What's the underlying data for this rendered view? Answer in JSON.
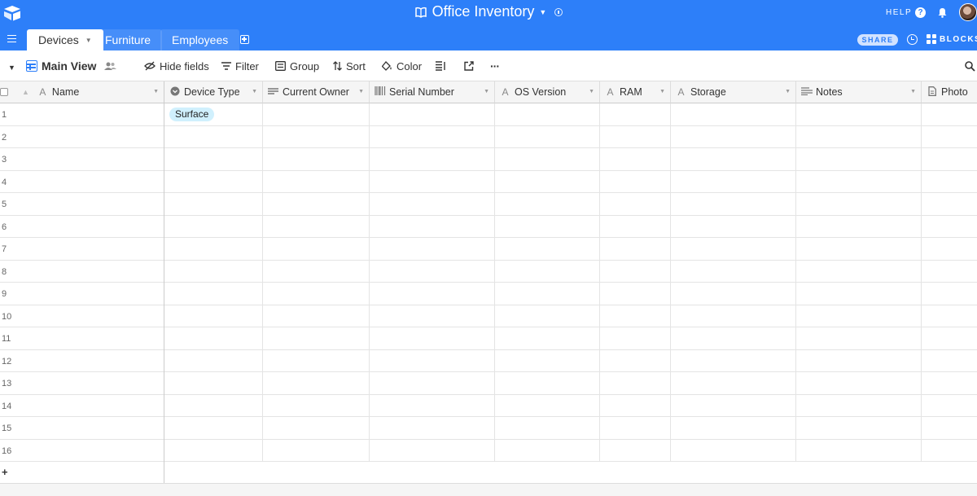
{
  "base": {
    "title": "Office Inventory"
  },
  "topbar": {
    "help_label": "HELP",
    "share_label": "SHARE",
    "blocks_label": "BLOCKS"
  },
  "tabs": [
    {
      "label": "Devices",
      "active": true
    },
    {
      "label": "Furniture",
      "active": false
    },
    {
      "label": "Employees",
      "active": false
    }
  ],
  "viewbar": {
    "view_name": "Main View",
    "hide_fields": "Hide fields",
    "filter": "Filter",
    "group": "Group",
    "sort": "Sort",
    "color": "Color"
  },
  "columns": [
    {
      "name": "Name",
      "icon": "text-icon"
    },
    {
      "name": "Device Type",
      "icon": "single-select-icon"
    },
    {
      "name": "Current Owner",
      "icon": "link-record-icon"
    },
    {
      "name": "Serial Number",
      "icon": "barcode-icon"
    },
    {
      "name": "OS Version",
      "icon": "text-icon"
    },
    {
      "name": "RAM",
      "icon": "text-icon"
    },
    {
      "name": "Storage",
      "icon": "text-icon"
    },
    {
      "name": "Notes",
      "icon": "long-text-icon"
    },
    {
      "name": "Photo",
      "icon": "attachment-icon"
    }
  ],
  "rows": [
    {
      "num": "1",
      "device_type": "Surface"
    },
    {
      "num": "2"
    },
    {
      "num": "3"
    },
    {
      "num": "4"
    },
    {
      "num": "5"
    },
    {
      "num": "6"
    },
    {
      "num": "7"
    },
    {
      "num": "8"
    },
    {
      "num": "9"
    },
    {
      "num": "10"
    },
    {
      "num": "11"
    },
    {
      "num": "12"
    },
    {
      "num": "13"
    },
    {
      "num": "14"
    },
    {
      "num": "15"
    },
    {
      "num": "16"
    }
  ],
  "add_row_label": "+",
  "colors": {
    "accent": "#2d7ff9",
    "pill_bg": "#d0f0fd"
  }
}
